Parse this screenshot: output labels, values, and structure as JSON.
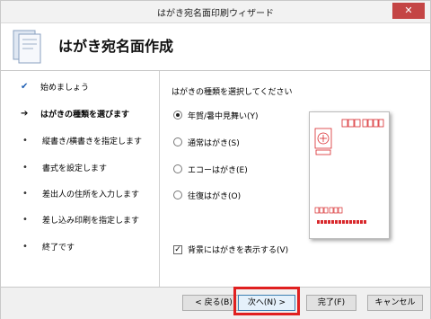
{
  "window": {
    "title": "はがき宛名面印刷ウィザード",
    "close_glyph": "✕"
  },
  "header": {
    "title": "はがき宛名面作成",
    "icon": "postcard-wizard-icon"
  },
  "sidebar": {
    "items": [
      {
        "label": "始めましょう",
        "state": "done"
      },
      {
        "label": "はがきの種類を選びます",
        "state": "current"
      },
      {
        "label": "縦書き/横書きを指定します",
        "state": "pending"
      },
      {
        "label": "書式を設定します",
        "state": "pending"
      },
      {
        "label": "差出人の住所を入力します",
        "state": "pending"
      },
      {
        "label": "差し込み印刷を指定します",
        "state": "pending"
      },
      {
        "label": "終了です",
        "state": "pending"
      }
    ],
    "marks": {
      "done": "✔",
      "current": "➔",
      "pending": "•"
    }
  },
  "main": {
    "prompt": "はがきの種類を選択してください",
    "options": [
      {
        "label": "年賀/暑中見舞い(Y)",
        "selected": true
      },
      {
        "label": "通常はがき(S)",
        "selected": false
      },
      {
        "label": "エコーはがき(E)",
        "selected": false
      },
      {
        "label": "往復はがき(O)",
        "selected": false
      }
    ],
    "show_background": {
      "label": "背景にはがきを表示する(V)",
      "checked": true,
      "check_glyph": "✓"
    }
  },
  "footer": {
    "back": "< 戻る(B)",
    "next": "次へ(N) >",
    "finish": "完了(F)",
    "cancel": "キャンセル"
  },
  "colors": {
    "accent": "#e02020",
    "stamp_red": "#d8282c",
    "check_blue": "#1f5fb4"
  }
}
